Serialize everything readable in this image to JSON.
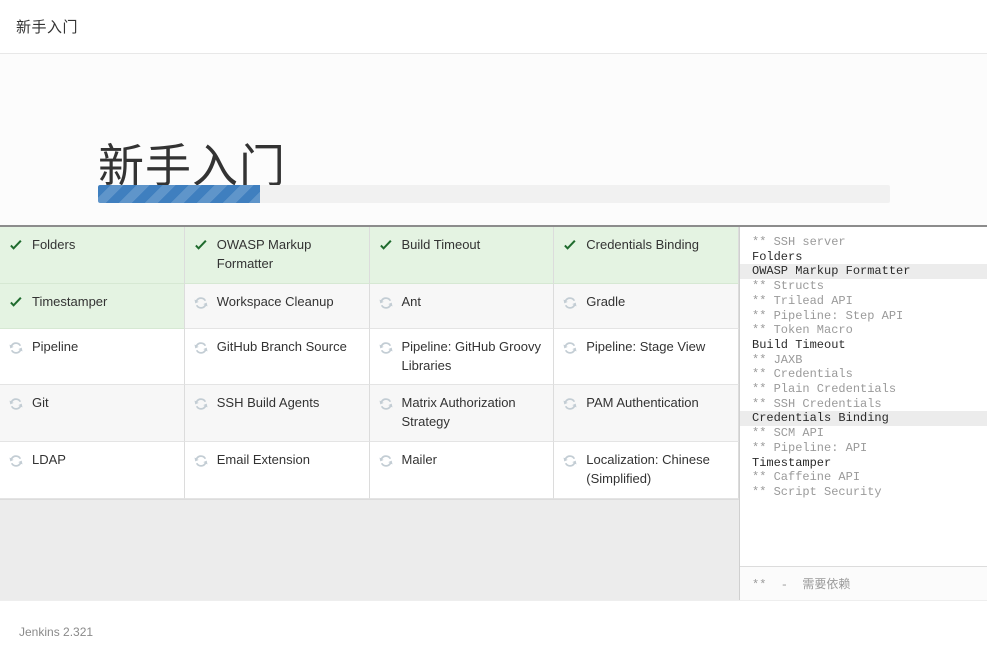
{
  "topbar": {
    "title": "新手入门"
  },
  "hero": {
    "title": "新手入门",
    "progress_percent": 20.5
  },
  "plugins": {
    "status_done": "done",
    "status_pending": "pending",
    "done_icon": "check-icon",
    "pending_icon": "refresh-icon",
    "items": [
      {
        "name": "Folders",
        "status": "done"
      },
      {
        "name": "OWASP Markup Formatter",
        "status": "done"
      },
      {
        "name": "Build Timeout",
        "status": "done"
      },
      {
        "name": "Credentials Binding",
        "status": "done"
      },
      {
        "name": "Timestamper",
        "status": "done"
      },
      {
        "name": "Workspace Cleanup",
        "status": "pending"
      },
      {
        "name": "Ant",
        "status": "pending"
      },
      {
        "name": "Gradle",
        "status": "pending"
      },
      {
        "name": "Pipeline",
        "status": "pending"
      },
      {
        "name": "GitHub Branch Source",
        "status": "pending"
      },
      {
        "name": "Pipeline: GitHub Groovy Libraries",
        "status": "pending"
      },
      {
        "name": "Pipeline: Stage View",
        "status": "pending"
      },
      {
        "name": "Git",
        "status": "pending"
      },
      {
        "name": "SSH Build Agents",
        "status": "pending"
      },
      {
        "name": "Matrix Authorization Strategy",
        "status": "pending"
      },
      {
        "name": "PAM Authentication",
        "status": "pending"
      },
      {
        "name": "LDAP",
        "status": "pending"
      },
      {
        "name": "Email Extension",
        "status": "pending"
      },
      {
        "name": "Mailer",
        "status": "pending"
      },
      {
        "name": "Localization: Chinese (Simplified)",
        "status": "pending"
      }
    ]
  },
  "log": {
    "lines": [
      {
        "text": "** SSH server",
        "type": "dep",
        "highlight": false
      },
      {
        "text": "Folders",
        "type": "plugin",
        "highlight": false
      },
      {
        "text": "OWASP Markup Formatter",
        "type": "plugin",
        "highlight": true
      },
      {
        "text": "** Structs",
        "type": "dep",
        "highlight": false
      },
      {
        "text": "** Trilead API",
        "type": "dep",
        "highlight": false
      },
      {
        "text": "** Pipeline: Step API",
        "type": "dep",
        "highlight": false
      },
      {
        "text": "** Token Macro",
        "type": "dep",
        "highlight": false
      },
      {
        "text": "Build Timeout",
        "type": "plugin",
        "highlight": false
      },
      {
        "text": "** JAXB",
        "type": "dep",
        "highlight": false
      },
      {
        "text": "** Credentials",
        "type": "dep",
        "highlight": false
      },
      {
        "text": "** Plain Credentials",
        "type": "dep",
        "highlight": false
      },
      {
        "text": "** SSH Credentials",
        "type": "dep",
        "highlight": false
      },
      {
        "text": "Credentials Binding",
        "type": "plugin",
        "highlight": true
      },
      {
        "text": "** SCM API",
        "type": "dep",
        "highlight": false
      },
      {
        "text": "** Pipeline: API",
        "type": "dep",
        "highlight": false
      },
      {
        "text": "Timestamper",
        "type": "plugin",
        "highlight": false
      },
      {
        "text": "** Caffeine API",
        "type": "dep",
        "highlight": false
      },
      {
        "text": "** Script Security",
        "type": "dep",
        "highlight": false
      }
    ],
    "legend": "**  -  需要依赖"
  },
  "footer": {
    "version": "Jenkins 2.321"
  },
  "colors": {
    "progress_fill": "#3f7fbf",
    "progress_track": "#f1f1f1",
    "done_background": "#e4f3e2",
    "check_icon": "#1f6b2e",
    "refresh_icon": "#c3cdd4"
  }
}
